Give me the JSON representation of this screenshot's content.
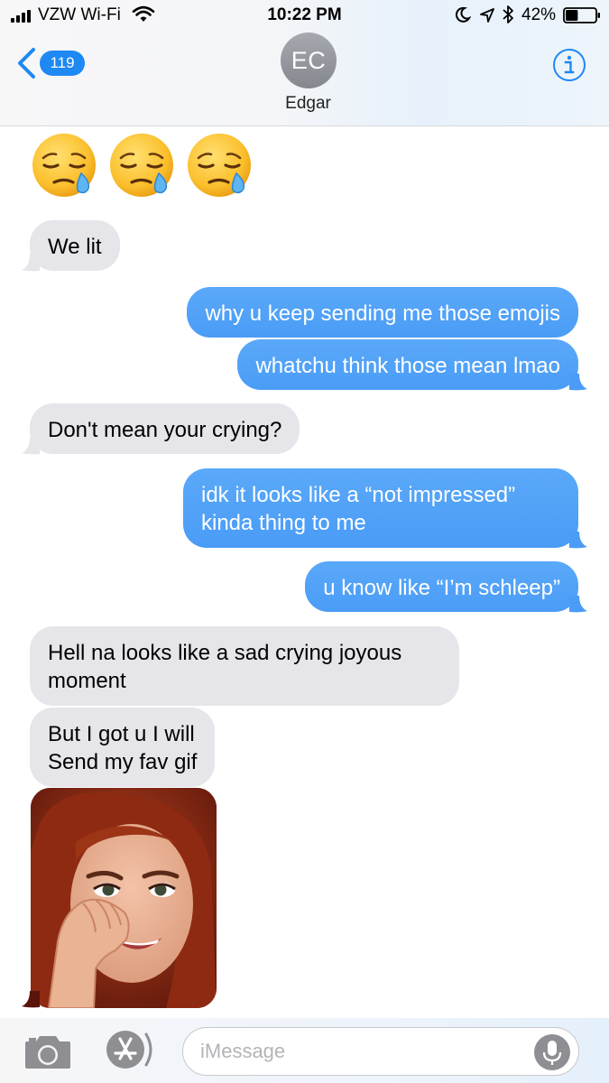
{
  "status_bar": {
    "carrier": "VZW Wi-Fi",
    "time": "10:22 PM",
    "battery": "42%",
    "battery_level": 0.42,
    "icons": [
      "signal-icon",
      "wifi-icon",
      "moon-icon",
      "location-icon",
      "bluetooth-icon",
      "battery-icon"
    ]
  },
  "header": {
    "back_count": "119",
    "contact_initials": "EC",
    "contact_name": "Edgar",
    "icons": [
      "chevron-left-icon",
      "info-icon"
    ]
  },
  "messages": [
    {
      "from": "them",
      "type": "emoji",
      "content": "😪😪😪"
    },
    {
      "from": "them",
      "type": "text",
      "text": "We lit"
    },
    {
      "from": "me",
      "type": "text",
      "text": "why u keep sending me those emojis"
    },
    {
      "from": "me",
      "type": "text",
      "text": "whatchu think those mean lmao"
    },
    {
      "from": "them",
      "type": "text",
      "text": "Don't mean your crying?"
    },
    {
      "from": "me",
      "type": "text",
      "text": "idk it looks like a “not impressed”\nkinda thing to me"
    },
    {
      "from": "me",
      "type": "text",
      "text": "u know like “I’m schleep”"
    },
    {
      "from": "them",
      "type": "text",
      "text": "Hell na looks like a sad crying joyous\nmoment"
    },
    {
      "from": "them",
      "type": "text",
      "text": "But I got u I will\nSend my fav gif"
    },
    {
      "from": "them",
      "type": "gif",
      "content": "gif"
    }
  ],
  "input": {
    "placeholder": "iMessage",
    "icons": [
      "camera-icon",
      "app-store-icon",
      "microphone-icon"
    ]
  },
  "colors": {
    "outgoing_bubble": "#4a9cf6",
    "incoming_bubble": "#e5e5ea",
    "accent": "#1e88f3",
    "avatar": "#9a9ca3"
  }
}
